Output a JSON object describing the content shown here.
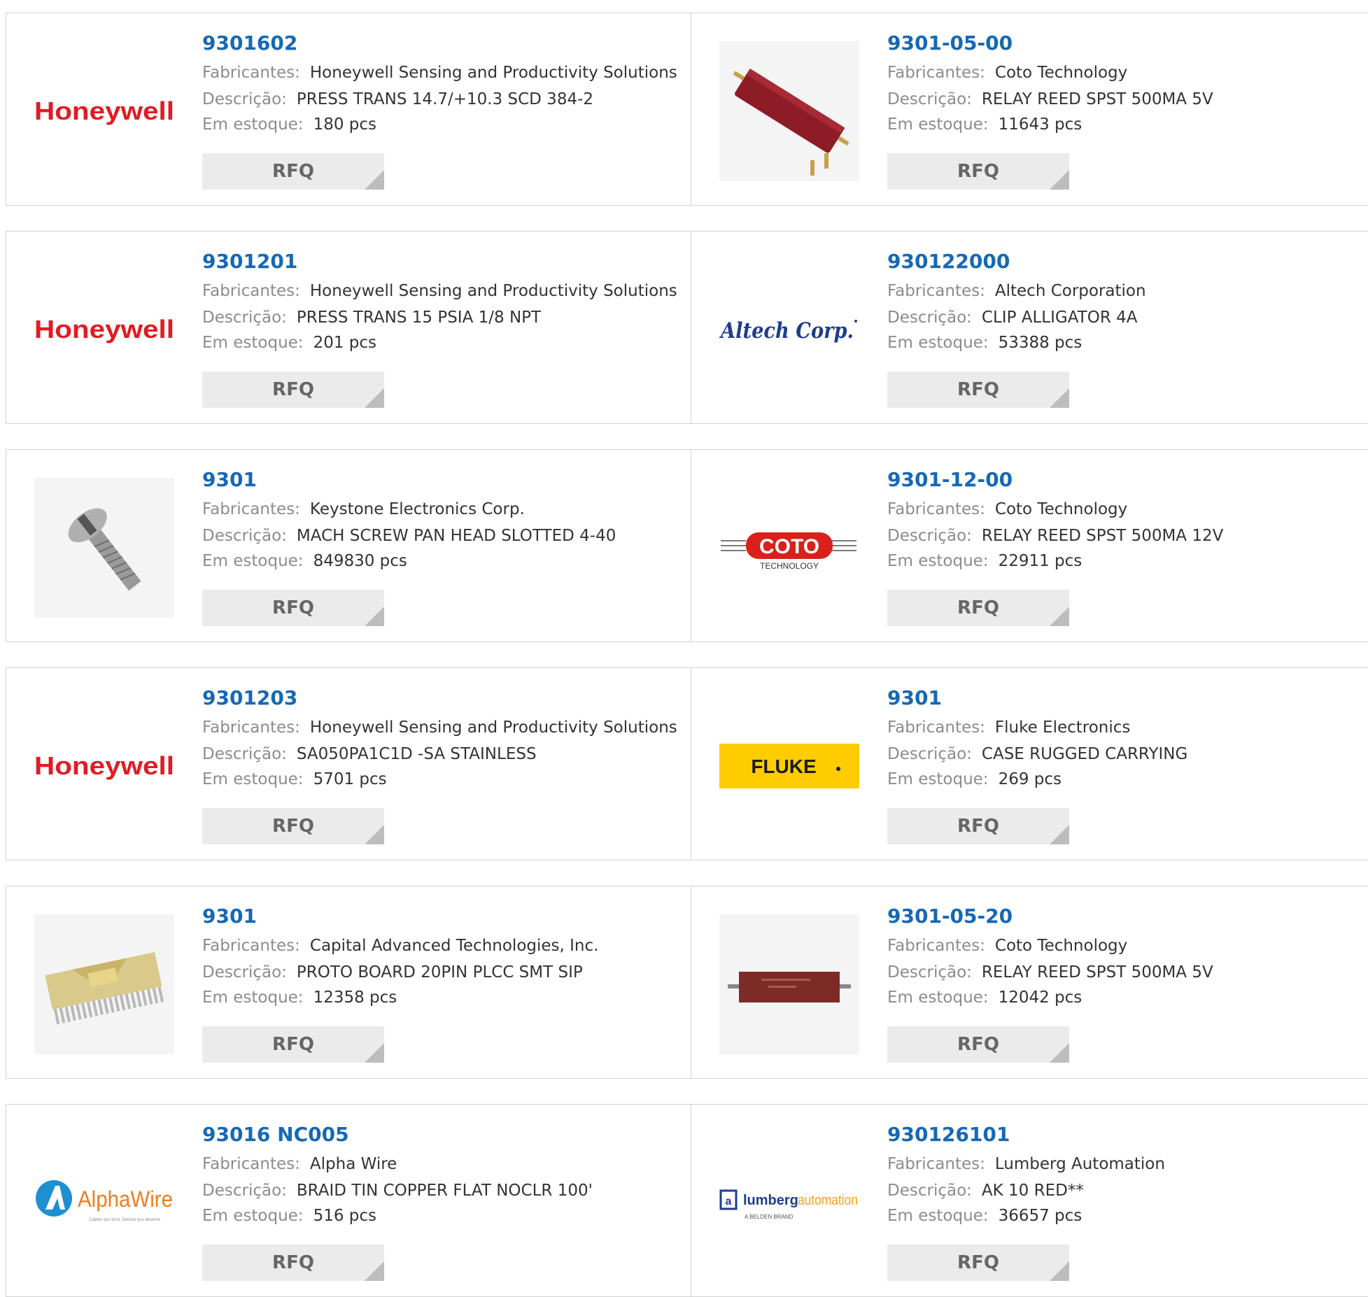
{
  "labels": {
    "manufacturer": "Fabricantes:",
    "description": "Descrição:",
    "stock": "Em estoque:",
    "rfq": "RFQ"
  },
  "colors": {
    "part_link": "#1668b4",
    "label_gray": "#8c8c8c",
    "value_text": "#333333",
    "button_bg": "#ebebeb",
    "border": "#d2d2d2"
  },
  "products": [
    {
      "part": "9301602",
      "manufacturer": "Honeywell Sensing and Productivity Solutions",
      "description": "PRESS TRANS 14.7/+10.3 SCD 384-2",
      "stock": "180 pcs",
      "image": "honeywell-logo",
      "logo_text": "Honeywell"
    },
    {
      "part": "9301-05-00",
      "manufacturer": "Coto Technology",
      "description": "RELAY REED SPST 500MA 5V",
      "stock": "11643 pcs",
      "image": "red-relay-photo"
    },
    {
      "part": "9301201",
      "manufacturer": "Honeywell Sensing and Productivity Solutions",
      "description": "PRESS TRANS 15 PSIA 1/8 NPT",
      "stock": "201 pcs",
      "image": "honeywell-logo",
      "logo_text": "Honeywell"
    },
    {
      "part": "930122000",
      "manufacturer": "Altech Corporation",
      "description": "CLIP ALLIGATOR 4A",
      "stock": "53388 pcs",
      "image": "altech-logo",
      "logo_text": "Altech Corp."
    },
    {
      "part": "9301",
      "manufacturer": "Keystone Electronics Corp.",
      "description": "MACH SCREW PAN HEAD SLOTTED 4-40",
      "stock": "849830 pcs",
      "image": "screw-photo"
    },
    {
      "part": "9301-12-00",
      "manufacturer": "Coto Technology",
      "description": "RELAY REED SPST 500MA 12V",
      "stock": "22911 pcs",
      "image": "coto-logo",
      "logo_text": "COTO",
      "logo_subtext": "TECHNOLOGY"
    },
    {
      "part": "9301203",
      "manufacturer": "Honeywell Sensing and Productivity Solutions",
      "description": "SA050PA1C1D -SA STAINLESS",
      "stock": "5701 pcs",
      "image": "honeywell-logo",
      "logo_text": "Honeywell"
    },
    {
      "part": "9301",
      "manufacturer": "Fluke Electronics",
      "description": "CASE RUGGED CARRYING",
      "stock": "269 pcs",
      "image": "fluke-logo",
      "logo_text": "FLUKE"
    },
    {
      "part": "9301",
      "manufacturer": "Capital Advanced Technologies, Inc.",
      "description": "PROTO BOARD 20PIN PLCC SMT SIP",
      "stock": "12358 pcs",
      "image": "proto-board-photo"
    },
    {
      "part": "9301-05-20",
      "manufacturer": "Coto Technology",
      "description": "RELAY REED SPST 500MA 5V",
      "stock": "12042 pcs",
      "image": "relay-flat-photo"
    },
    {
      "part": "93016 NC005",
      "manufacturer": "Alpha Wire",
      "description": "BRAID TIN COPPER FLAT NOCLR 100'",
      "stock": "516 pcs",
      "image": "alphawire-logo",
      "logo_text": "AlphaWire",
      "logo_subtext": "Cables you trust. Service you deserve."
    },
    {
      "part": "930126101",
      "manufacturer": "Lumberg Automation",
      "description": "AK 10 RED**",
      "stock": "36657 pcs",
      "image": "lumberg-logo",
      "logo_text": "lumberg",
      "logo_text2": "automation",
      "logo_subtext": "A BELDEN BRAND"
    }
  ]
}
